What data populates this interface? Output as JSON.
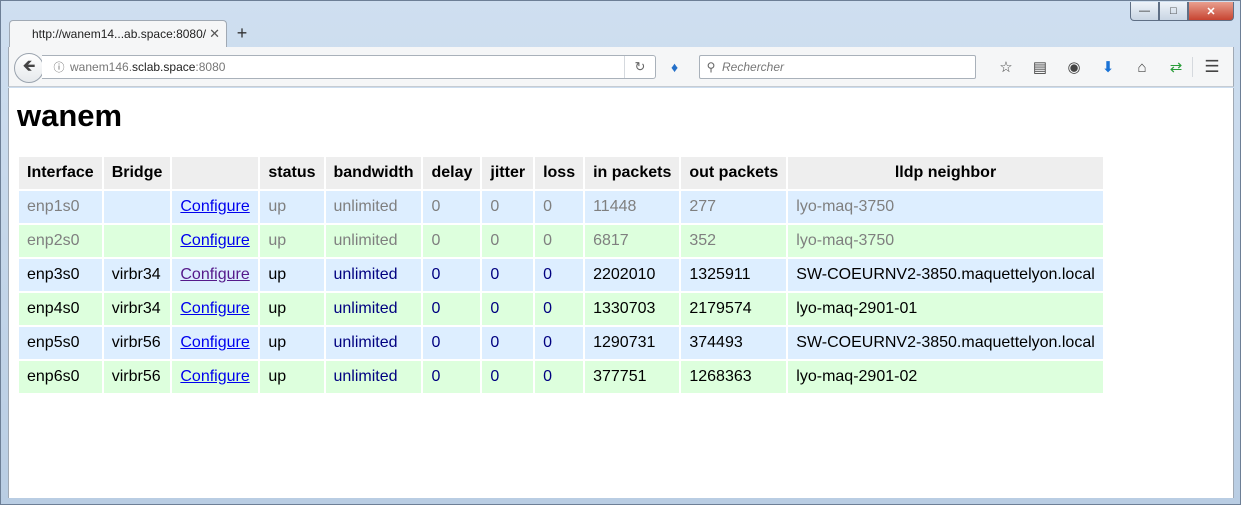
{
  "browser": {
    "tab_title": "http://wanem14...ab.space:8080/",
    "url_host_prefix": "wanem146.",
    "url_host_main": "sclab.space",
    "url_port": ":8080",
    "search_placeholder": "Rechercher"
  },
  "page": {
    "title": "wanem",
    "headers": [
      "Interface",
      "Bridge",
      "",
      "status",
      "bandwidth",
      "delay",
      "jitter",
      "loss",
      "in packets",
      "out packets",
      "lldp neighbor"
    ],
    "rows": [
      {
        "interface": "enp1s0",
        "bridge": "",
        "link": "Configure",
        "status": "up",
        "bandwidth": "unlimited",
        "delay": "0",
        "jitter": "0",
        "loss": "0",
        "in_packets": "11448",
        "out_packets": "277",
        "lldp": "lyo-maq-3750"
      },
      {
        "interface": "enp2s0",
        "bridge": "",
        "link": "Configure",
        "status": "up",
        "bandwidth": "unlimited",
        "delay": "0",
        "jitter": "0",
        "loss": "0",
        "in_packets": "6817",
        "out_packets": "352",
        "lldp": "lyo-maq-3750"
      },
      {
        "interface": "enp3s0",
        "bridge": "virbr34",
        "link": "Configure",
        "status": "up",
        "bandwidth": "unlimited",
        "delay": "0",
        "jitter": "0",
        "loss": "0",
        "in_packets": "2202010",
        "out_packets": "1325911",
        "lldp": "SW-COEURNV2-3850.maquettelyon.local"
      },
      {
        "interface": "enp4s0",
        "bridge": "virbr34",
        "link": "Configure",
        "status": "up",
        "bandwidth": "unlimited",
        "delay": "0",
        "jitter": "0",
        "loss": "0",
        "in_packets": "1330703",
        "out_packets": "2179574",
        "lldp": "lyo-maq-2901-01"
      },
      {
        "interface": "enp5s0",
        "bridge": "virbr56",
        "link": "Configure",
        "status": "up",
        "bandwidth": "unlimited",
        "delay": "0",
        "jitter": "0",
        "loss": "0",
        "in_packets": "1290731",
        "out_packets": "374493",
        "lldp": "SW-COEURNV2-3850.maquettelyon.local"
      },
      {
        "interface": "enp6s0",
        "bridge": "virbr56",
        "link": "Configure",
        "status": "up",
        "bandwidth": "unlimited",
        "delay": "0",
        "jitter": "0",
        "loss": "0",
        "in_packets": "377751",
        "out_packets": "1268363",
        "lldp": "lyo-maq-2901-02"
      }
    ]
  }
}
